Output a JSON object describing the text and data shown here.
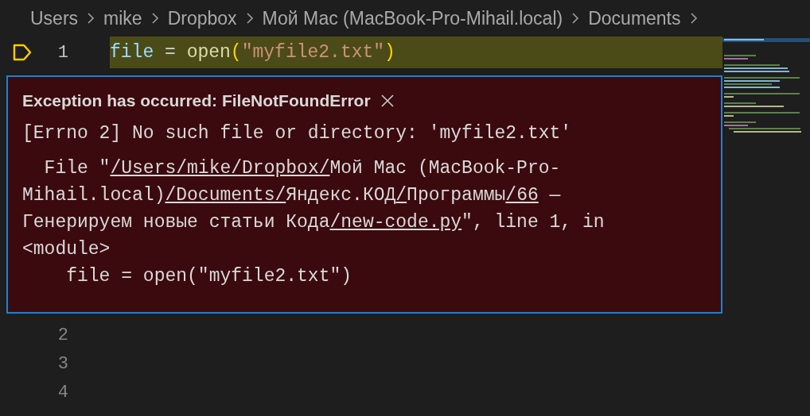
{
  "breadcrumb": [
    "Users",
    "mike",
    "Dropbox",
    "Мой Мас (MacBook-Pro-Mihail.local)",
    "Documents"
  ],
  "current_line": {
    "number": "1",
    "breakpoint": true,
    "tokens": [
      {
        "kind": "variable",
        "text": "file"
      },
      {
        "kind": "operator",
        "text": " = "
      },
      {
        "kind": "function",
        "text": "open"
      },
      {
        "kind": "bracket",
        "text": "("
      },
      {
        "kind": "string",
        "text": "\"myfile2.txt\""
      },
      {
        "kind": "bracket",
        "text": ")"
      }
    ]
  },
  "exception": {
    "title": "Exception has occurred: FileNotFoundError",
    "message": "[Errno 2] No such file or directory: 'myfile2.txt'",
    "trace": [
      {
        "link": false,
        "text": "  File \""
      },
      {
        "link": true,
        "text": "/Users/mike/Dropbox/"
      },
      {
        "link": false,
        "text": "Мой Мас (MacBook-Pro-Mihail.local)"
      },
      {
        "link": true,
        "text": "/Documents/"
      },
      {
        "link": false,
        "text": "Яндекс.КОД"
      },
      {
        "link": true,
        "text": "/"
      },
      {
        "link": false,
        "text": "Программы"
      },
      {
        "link": true,
        "text": "/66"
      },
      {
        "link": false,
        "text": " — Генерируем новые статьи Кода"
      },
      {
        "link": true,
        "text": "/new-code.py"
      },
      {
        "link": false,
        "text": "\", line 1, in <module>"
      }
    ],
    "source": "    file = open(\"myfile2.txt\")"
  },
  "line_numbers": [
    "2",
    "3",
    "4"
  ]
}
